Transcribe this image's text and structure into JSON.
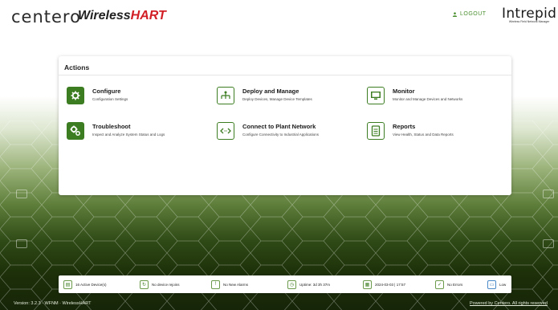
{
  "header": {
    "logo_centero": "centero",
    "logo_wireless": "Wireless",
    "logo_hart": "HART",
    "logout_label": "LOGOUT",
    "logo_intrepid": "Intrepid",
    "intrepid_tagline": "Wireless Field Network Manager"
  },
  "actions": {
    "title": "Actions",
    "items": [
      {
        "title": "Configure",
        "desc": "Configuration Settings",
        "icon": "gear-icon"
      },
      {
        "title": "Deploy and Manage",
        "desc": "Deploy Devices, Manage Device Templates",
        "icon": "network-tree-icon"
      },
      {
        "title": "Monitor",
        "desc": "Monitor and Manage Devices and Networks",
        "icon": "monitor-icon"
      },
      {
        "title": "Troubleshoot",
        "desc": "Inspect and Analyze System Status and Logs",
        "icon": "gears-icon"
      },
      {
        "title": "Connect to Plant Network",
        "desc": "Configure Connectivity to Industrial Applications",
        "icon": "connect-arrows-icon"
      },
      {
        "title": "Reports",
        "desc": "View Health, Status and Data Reports",
        "icon": "report-icon"
      }
    ]
  },
  "status": {
    "active_devices": "16 Active Device(s)",
    "device_rejoins": "No device rejoins",
    "alarms": "No New Alarms",
    "uptime": "Uptime: 3d 3h 37m",
    "datetime": "2024-03-03 | 17:57",
    "errors": "No Errors",
    "level": "Low"
  },
  "footer": {
    "version": "Version: 3.2.3 · WFNM · WirelessHART",
    "powered": "Powered by Centero. All rights reserved"
  },
  "colors": {
    "accent_green": "#3d7d22",
    "brand_red": "#d21f26"
  }
}
